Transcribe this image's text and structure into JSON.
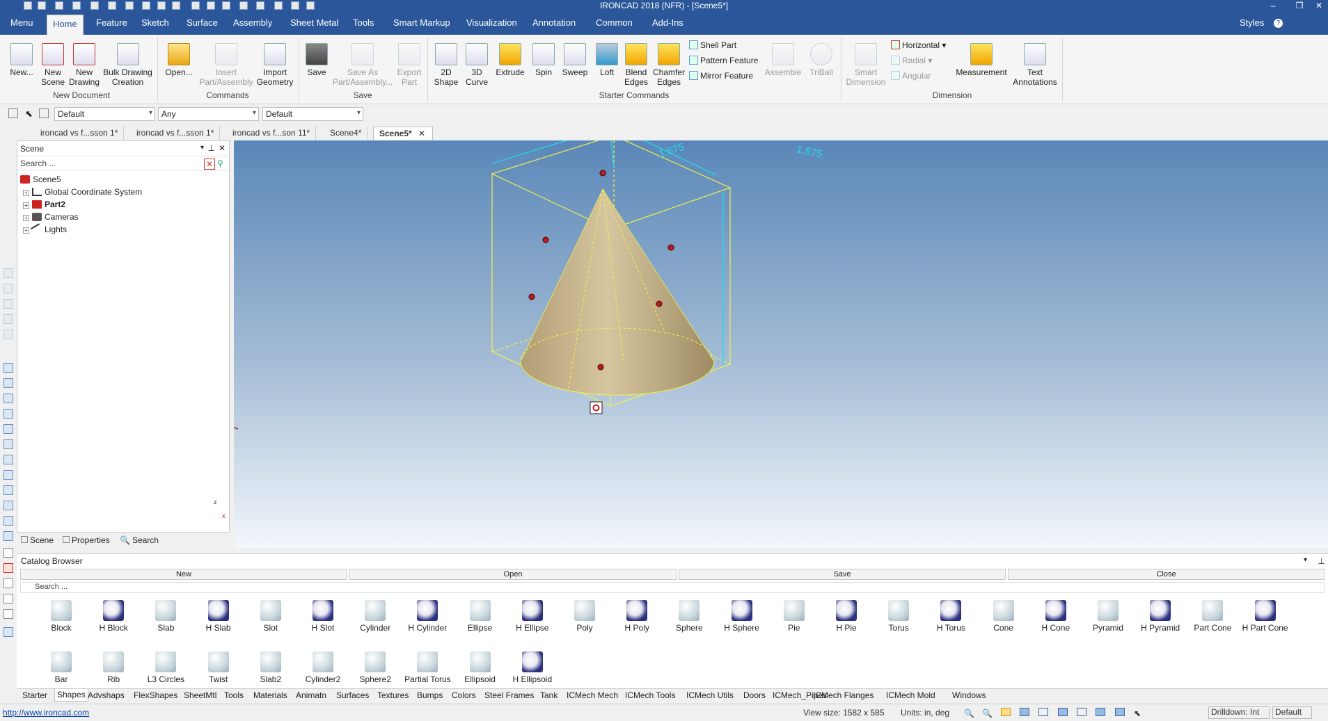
{
  "window": {
    "title": "IRONCAD 2018 (NFR) - [Scene5*]",
    "minimize": "–",
    "restore": "❐",
    "close": "✕"
  },
  "ribbon_tabs": [
    "Menu",
    "Home",
    "Feature",
    "Sketch",
    "Surface",
    "Assembly",
    "Sheet Metal",
    "Tools",
    "Smart Markup",
    "Visualization",
    "Annotation",
    "Common",
    "Add-Ins"
  ],
  "styles_label": "Styles",
  "ribbon": {
    "new": "New...",
    "new_scene": "New\nScene",
    "new_drawing": "New\nDrawing",
    "bulk_drawing": "Bulk Drawing\nCreation",
    "group_new_document": "New Document",
    "open": "Open...",
    "insert_part": "Insert\nPart/Assembly",
    "import_geometry": "Import\nGeometry",
    "group_commands": "Commands",
    "save": "Save",
    "save_as": "Save As\nPart/Assembly...",
    "export_part": "Export\nPart",
    "group_save": "Save",
    "shape_2d": "2D\nShape",
    "curve_3d": "3D\nCurve",
    "extrude": "Extrude",
    "spin": "Spin",
    "sweep": "Sweep",
    "loft": "Loft",
    "blend_edges": "Blend\nEdges",
    "chamfer_edges": "Chamfer\nEdges",
    "shell_part": "Shell Part",
    "pattern_feature": "Pattern Feature",
    "mirror_feature": "Mirror Feature",
    "assemble": "Assemble",
    "triball": "TriBall",
    "group_starter": "Starter Commands",
    "smart_dimension": "Smart\nDimension",
    "horizontal": "Horizontal",
    "radial": "Radial",
    "angular": "Angular",
    "measurement": "Measurement",
    "text_annotations": "Text\nAnnotations",
    "group_dimension": "Dimension"
  },
  "toolbar": {
    "dropdown1": "Default",
    "dropdown2": "Any",
    "dropdown3": "Default"
  },
  "doc_tabs": [
    "ironcad vs f...sson 1*",
    "ironcad vs f...sson 1*",
    "ironcad vs f...son 11*",
    "Scene4*",
    "Scene5*"
  ],
  "scene_panel": {
    "title": "Scene",
    "search_placeholder": "Search ...",
    "tree": [
      {
        "label": "Scene5",
        "icon": "scene-icon"
      },
      {
        "label": "Global Coordinate System",
        "icon": "axes-icon"
      },
      {
        "label": "Part2",
        "icon": "part-icon"
      },
      {
        "label": "Cameras",
        "icon": "camera-icon"
      },
      {
        "label": "Lights",
        "icon": "light-icon"
      }
    ],
    "tabs": [
      "Scene",
      "Properties",
      "Search"
    ]
  },
  "viewport": {
    "dim_width": "1.575",
    "dim_depth": "1.575",
    "axis_x": "x",
    "axis_z": "z"
  },
  "catalog": {
    "title": "Catalog Browser",
    "btn_new": "New",
    "btn_open": "Open",
    "btn_save": "Save",
    "btn_close": "Close",
    "search_placeholder": "Search ...",
    "shapes_row1": [
      "Block",
      "H Block",
      "Slab",
      "H Slab",
      "Slot",
      "H Slot",
      "Cylinder",
      "H Cylinder",
      "Ellipse",
      "H Ellipse",
      "Poly",
      "H Poly",
      "Sphere",
      "H Sphere",
      "Pie",
      "H Pie",
      "Torus",
      "H Torus",
      "Cone",
      "H Cone",
      "Pyramid",
      "H Pyramid",
      "Part Cone",
      "H Part Cone"
    ],
    "shapes_row2": [
      "Bar",
      "Rib",
      "L3 Circles",
      "Twist",
      "Slab2",
      "Cylinder2",
      "Sphere2",
      "Partial Torus",
      "Ellipsoid",
      "H Ellipsoid"
    ],
    "tabs": [
      "Starter",
      "Shapes",
      "Advshaps",
      "FlexShapes",
      "SheetMtl",
      "Tools",
      "Materials",
      "Animatn",
      "Surfaces",
      "Textures",
      "Bumps",
      "Colors",
      "Steel Frames",
      "Tank",
      "ICMech Mech",
      "ICMech Tools",
      "ICMech Utils",
      "Doors",
      "ICMech_Pipes",
      "ICMech Flanges",
      "ICMech Mold",
      "Windows"
    ]
  },
  "status": {
    "url": "http://www.ironcad.com",
    "view_size": "View size: 1582 x 585",
    "units": "Units: in, deg",
    "drilldown": "Drilldown: Int",
    "mode": "Default"
  }
}
